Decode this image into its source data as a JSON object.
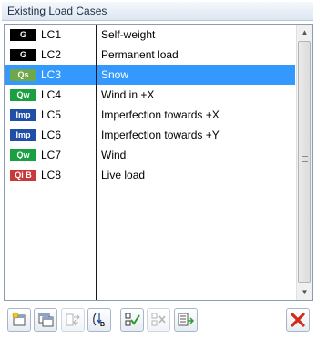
{
  "header": {
    "title": "Existing Load Cases"
  },
  "load_cases": [
    {
      "badge": "G",
      "badge_color": "#000000",
      "name": "LC1",
      "description": "Self-weight"
    },
    {
      "badge": "G",
      "badge_color": "#000000",
      "name": "LC2",
      "description": "Permanent load"
    },
    {
      "badge": "Qs",
      "badge_color": "#6fa84a",
      "name": "LC3",
      "description": "Snow",
      "selected": true
    },
    {
      "badge": "Qw",
      "badge_color": "#1aa040",
      "name": "LC4",
      "description": "Wind in +X"
    },
    {
      "badge": "Imp",
      "badge_color": "#1f4fa6",
      "name": "LC5",
      "description": "Imperfection towards +X"
    },
    {
      "badge": "Imp",
      "badge_color": "#1f4fa6",
      "name": "LC6",
      "description": "Imperfection towards +Y"
    },
    {
      "badge": "Qw",
      "badge_color": "#1aa040",
      "name": "LC7",
      "description": "Wind"
    },
    {
      "badge": "Qi B",
      "badge_color": "#c83a3a",
      "name": "LC8",
      "description": "Live load"
    }
  ],
  "colors": {
    "selection": "#3399ff"
  },
  "toolbar": {
    "buttons": [
      {
        "icon": "new-load-case-icon"
      },
      {
        "icon": "copy-load-case-icon"
      },
      {
        "icon": "renumber-icon",
        "disabled": true
      },
      {
        "icon": "load-case-settings-icon"
      },
      {
        "icon": "check-all-icon"
      },
      {
        "icon": "uncheck-all-icon",
        "disabled": true
      },
      {
        "icon": "import-icon"
      },
      {
        "icon": "delete-icon"
      }
    ]
  }
}
